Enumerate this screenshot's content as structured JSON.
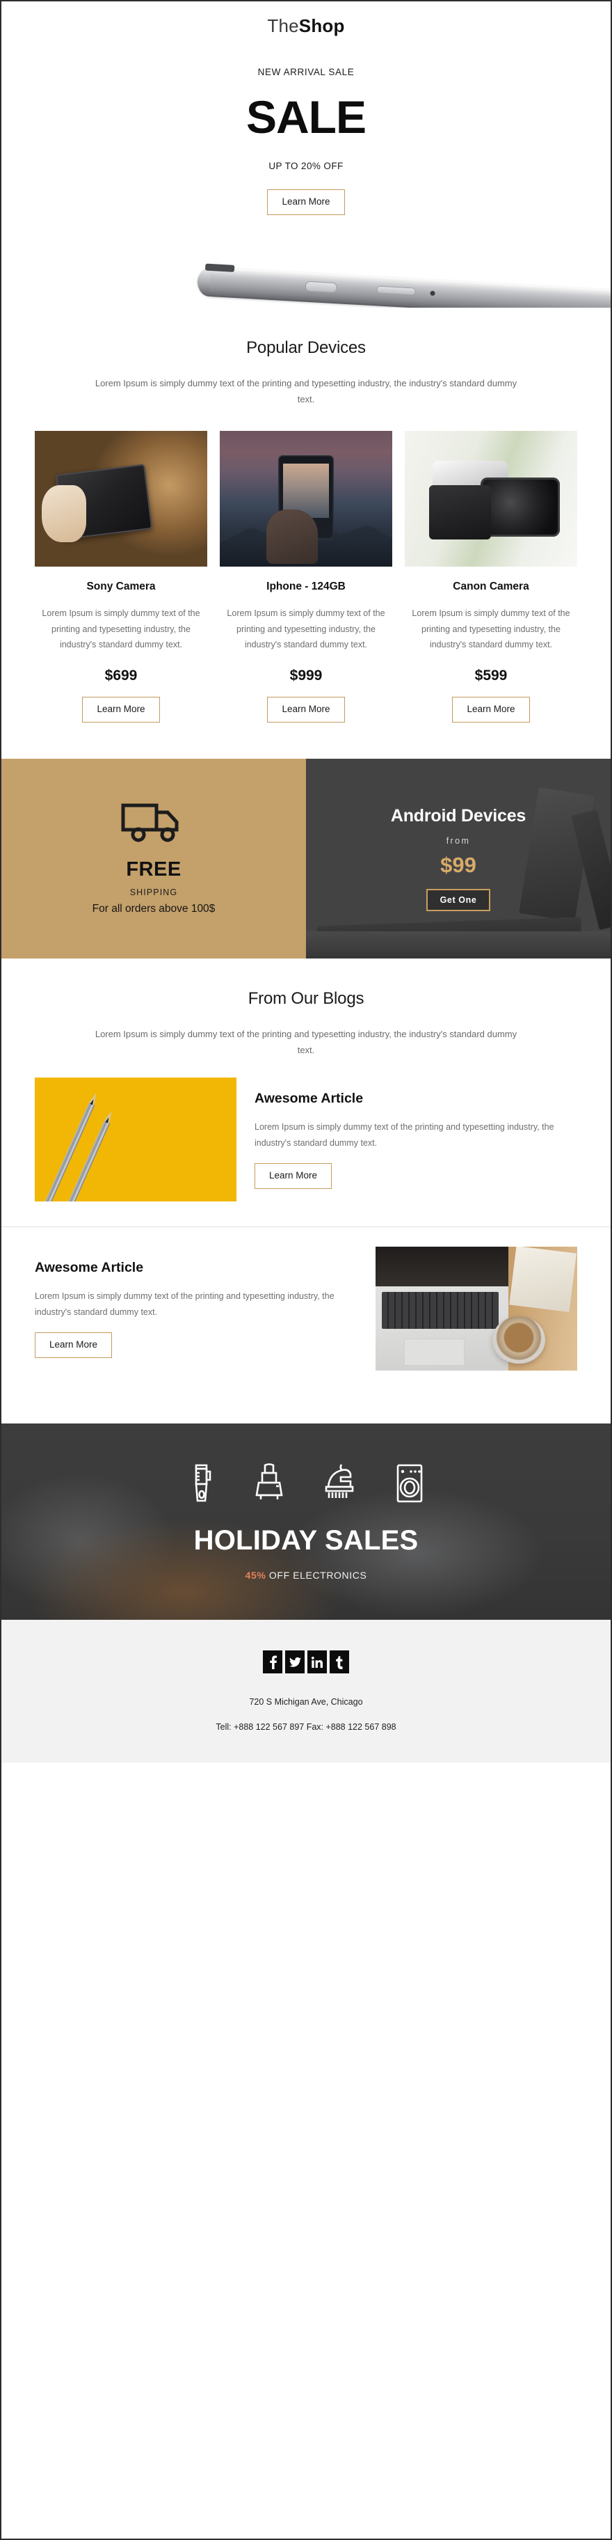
{
  "brand": {
    "name_light": "The",
    "name_bold": "Shop",
    "accent_gold": "#c49a5e",
    "promo_gold": "#c4a06a",
    "dark": "#3f3f3f",
    "price_gold": "#d7ab69",
    "discount_orange": "#e2825a",
    "pencil_yellow": "#f2b705"
  },
  "hero": {
    "kicker": "NEW ARRIVAL SALE",
    "title": "SALE",
    "subtitle": "UP TO 20% OFF",
    "cta": "Learn More",
    "image_alt": "silver-smartphone-side-profile"
  },
  "popular": {
    "title": "Popular Devices",
    "description": "Lorem Ipsum is simply dummy text of the printing and typesetting industry, the industry's standard dummy text.",
    "products": [
      {
        "name": "Sony Camera",
        "description": "Lorem Ipsum is simply dummy text of the printing and typesetting industry, the industry's standard dummy text.",
        "price": "$699",
        "cta": "Learn More",
        "image_alt": "woman-holding-compact-sony-camera"
      },
      {
        "name": "Iphone - 124GB",
        "description": "Lorem Ipsum is simply dummy text of the printing and typesetting industry, the industry's standard dummy text.",
        "price": "$999",
        "cta": "Learn More",
        "image_alt": "hand-holding-iphone-photographing-mountains"
      },
      {
        "name": "Canon Camera",
        "description": "Lorem Ipsum is simply dummy text of the printing and typesetting industry, the industry's standard dummy text.",
        "price": "$599",
        "cta": "Learn More",
        "image_alt": "canon-dslr-camera-on-white-table"
      }
    ]
  },
  "promo": {
    "shipping": {
      "icon": "delivery-truck-icon",
      "headline": "FREE",
      "label": "SHIPPING",
      "detail": "For all orders above 100$"
    },
    "android": {
      "title": "Android Devices",
      "from_label": "from",
      "price": "$99",
      "cta": "Get One",
      "image_alt": "android-tablet-with-keyboard"
    }
  },
  "blogs": {
    "title": "From Our Blogs",
    "description": "Lorem Ipsum is simply dummy text of the printing and typesetting industry, the industry's standard dummy text.",
    "articles": [
      {
        "title": "Awesome Article",
        "description": "Lorem Ipsum is simply dummy text of the printing and typesetting industry, the industry's standard dummy text.",
        "cta": "Learn More",
        "image_alt": "two-pencils-on-yellow-background"
      },
      {
        "title": "Awesome Article",
        "description": "Lorem Ipsum is simply dummy text of the printing and typesetting industry, the industry's standard dummy text.",
        "cta": "Learn More",
        "image_alt": "laptop-notebook-and-coffee-on-wooden-desk"
      }
    ]
  },
  "holiday": {
    "icons": [
      "blender-icon",
      "toaster-icon",
      "steam-iron-icon",
      "washing-machine-icon"
    ],
    "title": "HOLIDAY SALES",
    "discount": "45%",
    "discount_suffix": " OFF ELECTRONICS",
    "image_alt": "coffee-beans-and-grinder-dark-background"
  },
  "footer": {
    "social": [
      {
        "name": "facebook-icon",
        "glyph": "f"
      },
      {
        "name": "twitter-icon",
        "glyph": "ᴛ"
      },
      {
        "name": "linkedin-icon",
        "glyph": "in"
      },
      {
        "name": "tumblr-icon",
        "glyph": "t"
      }
    ],
    "address": "720 S Michigan Ave, Chicago",
    "phone": "Tell: +888 122 567 897 Fax: +888 122 567 898"
  }
}
